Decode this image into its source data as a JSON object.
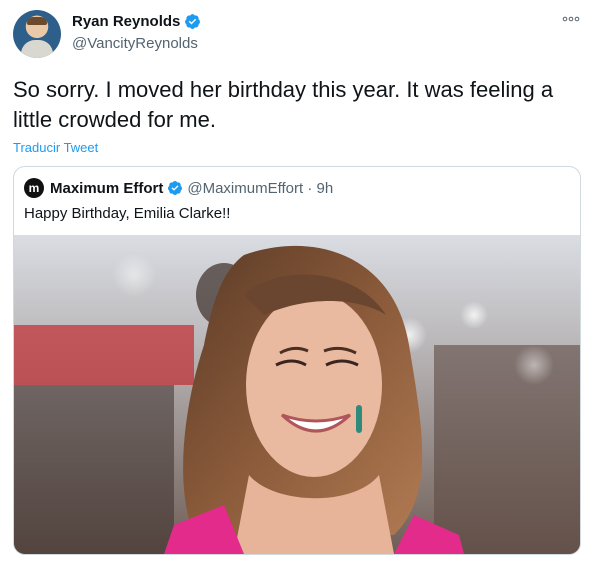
{
  "author": {
    "name": "Ryan Reynolds",
    "handle": "@VancityReynolds"
  },
  "tweet": {
    "text": "So sorry. I moved her birthday this year. It was feeling a little crowded for me.",
    "translate_label": "Traducir Tweet"
  },
  "quoted": {
    "avatar_letter": "m",
    "name": "Maximum Effort",
    "handle_time": "@MaximumEffort · 9h",
    "text": "Happy Birthday, Emilia Clarke!!"
  },
  "colors": {
    "verified_blue": "#1d9bf0",
    "link_blue": "#1d9bf0",
    "secondary_text": "#536471",
    "border": "#cfd9de"
  },
  "icons": {
    "verified": "verified-badge-icon",
    "more": "more-options-icon"
  }
}
